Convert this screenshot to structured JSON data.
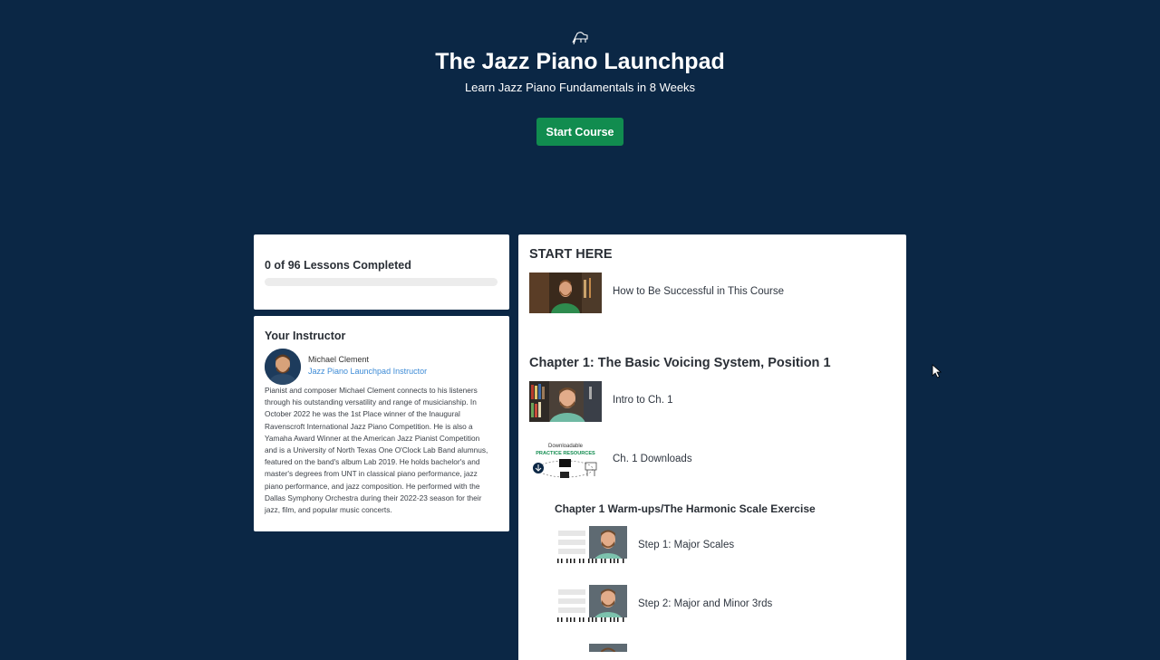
{
  "hero": {
    "icon": "piano-icon",
    "title": "The Jazz Piano Launchpad",
    "subtitle": "Learn Jazz Piano Fundamentals in 8 Weeks",
    "start_label": "Start Course"
  },
  "progress": {
    "label": "0 of 96 Lessons Completed",
    "completed": 0,
    "total": 96,
    "fraction": 0
  },
  "instructor": {
    "heading": "Your Instructor",
    "name": "Michael Clement",
    "role": "Jazz Piano Launchpad Instructor",
    "bio_lines": [
      "Pianist and composer Michael Clement connects to his listeners",
      "through his outstanding versatility and range of musicianship. In",
      "October 2022 he was the 1st Place winner of the Inaugural",
      "Ravenscroft International Jazz Piano Competition. He is also a",
      "Yamaha Award Winner at the American Jazz Pianist Competition",
      "and is a University of North Texas One O'Clock Lab Band alumnus,",
      "featured on the band's album Lab 2019. He holds bachelor's and",
      "master's degrees from UNT in classical piano performance, jazz",
      "piano performance, and jazz composition. He performed with the",
      "Dallas Symphony Orchestra during their 2022-23 season for their",
      "jazz, film, and popular music concerts."
    ]
  },
  "curriculum": {
    "start_here": {
      "title": "START HERE",
      "lessons": [
        {
          "title": "How to Be Successful in This Course",
          "thumb": "video-thumbnail"
        }
      ]
    },
    "chapter1": {
      "title": "Chapter 1: The Basic Voicing System, Position 1",
      "lessons": [
        {
          "title": "Intro to Ch. 1",
          "thumb": "video-thumbnail"
        },
        {
          "title": "Ch. 1 Downloads",
          "thumb": "downloads-thumbnail"
        }
      ],
      "downloads_thumb": {
        "line1": "Downloadable",
        "line2": "PRACTICE RESOURCES"
      },
      "warmups": {
        "title": "Chapter 1 Warm-ups/The Harmonic Scale Exercise",
        "lessons": [
          {
            "title": "Step 1: Major Scales",
            "thumb": "sheet-video-thumbnail"
          },
          {
            "title": "Step 2: Major and Minor 3rds",
            "thumb": "sheet-video-thumbnail"
          }
        ]
      }
    }
  },
  "colors": {
    "background": "#0b2745",
    "accent": "#118c4f",
    "link": "#3d8bd6"
  }
}
